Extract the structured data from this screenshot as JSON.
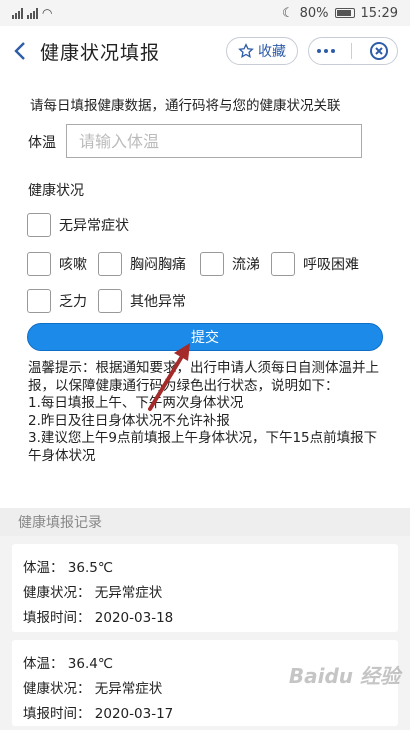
{
  "status_bar": {
    "signal": "4G",
    "battery": "80%",
    "time": "15:29"
  },
  "nav": {
    "title": "健康状况填报",
    "favorite_label": "收藏"
  },
  "notice": "请每日填报健康数据，通行码将与您的健康状况关联",
  "temperature": {
    "label": "体温",
    "placeholder": "请输入体温"
  },
  "health": {
    "label": "健康状况",
    "options": [
      "无异常症状",
      "咳嗽",
      "胸闷胸痛",
      "流涕",
      "呼吸困难",
      "乏力",
      "其他异常"
    ]
  },
  "submit_label": "提交",
  "tips": [
    "温馨提示：根据通知要求，出行申请人须每日自测体温并上报，以保障健康通行码为绿色出行状态，说明如下：",
    "1.每日填报上午、下午两次身体状况",
    "2.昨日及往日身体状况不允许补报",
    "3.建议您上午9点前填报上午身体状况，下午15点前填报下午身体状况"
  ],
  "records": {
    "header": "健康填报记录",
    "items": [
      {
        "temp": "体温：  36.5℃",
        "status": "健康状况：  无异常症状",
        "time": "填报时间：  2020-03-18"
      },
      {
        "temp": "体温：  36.4℃",
        "status": "健康状况：  无异常症状",
        "time": "填报时间：  2020-03-17"
      }
    ]
  },
  "watermark": "Baidu 经验",
  "colors": {
    "accent": "#1c8ae8",
    "nav_icon": "#2d5ca8",
    "arrow": "#a52a2a"
  }
}
